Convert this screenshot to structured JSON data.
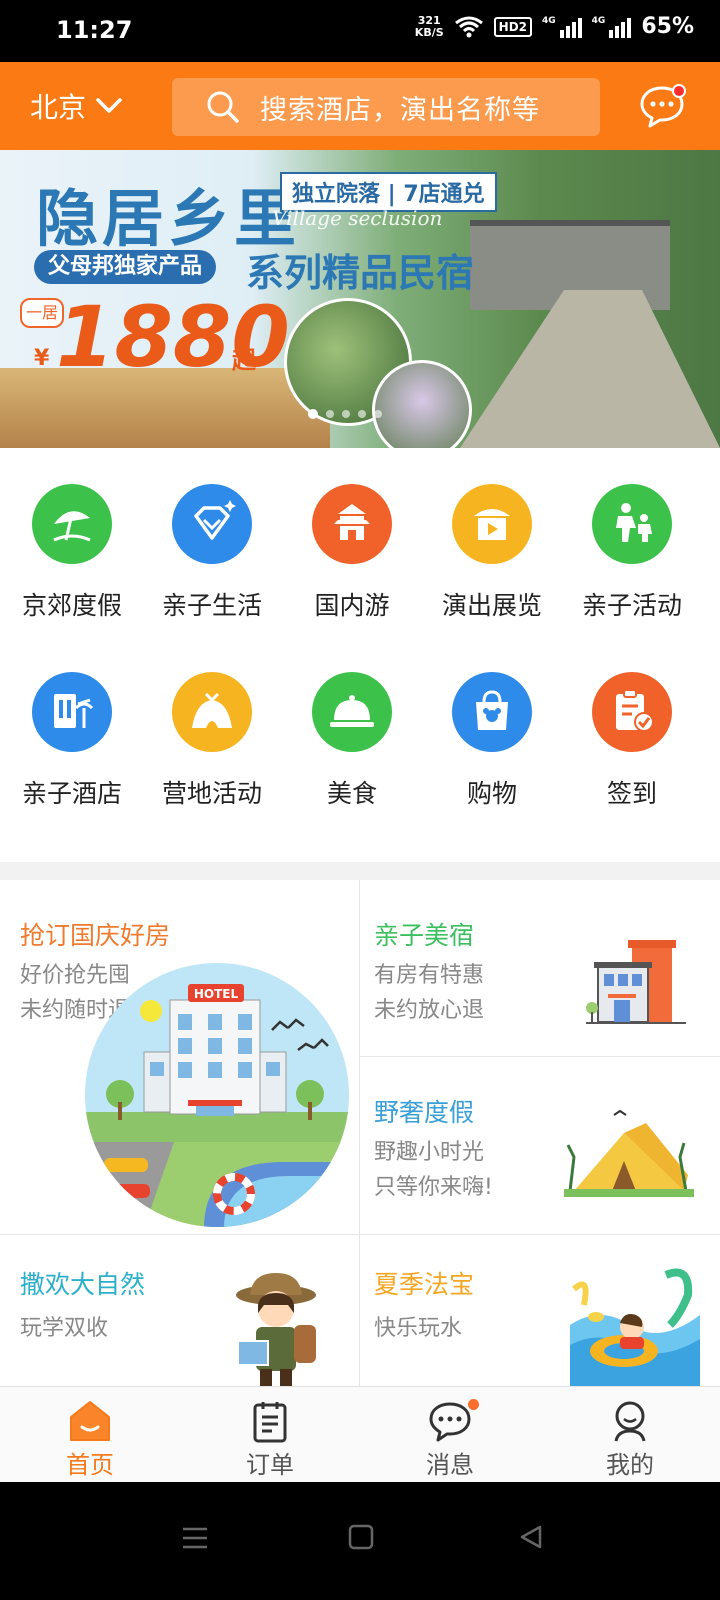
{
  "status_bar": {
    "time": "11:27",
    "speed_value": "321",
    "speed_unit": "KB/S",
    "hd": "HD2",
    "net1": "4G",
    "net2": "4G",
    "battery": "65%"
  },
  "header": {
    "city": "北京",
    "search_placeholder": "搜索酒店，演出名称等",
    "accent": "#fb7a14"
  },
  "banner": {
    "title": "隐居乡里",
    "tag": "独立院落 | 7店通兑",
    "english": "Village seclusion",
    "pill": "父母邦独家产品",
    "subtitle": "系列精品民宿",
    "prefix": "一居",
    "currency": "¥",
    "price": "1880",
    "suffix": "起",
    "slide_count": 5,
    "active_slide": 1
  },
  "categories": [
    {
      "label": "京郊度假",
      "icon": "beach-umbrella-icon",
      "color": "#3cc24a"
    },
    {
      "label": "亲子生活",
      "icon": "diamond-icon",
      "color": "#2e8bea"
    },
    {
      "label": "国内游",
      "icon": "temple-icon",
      "color": "#f1622a"
    },
    {
      "label": "演出展览",
      "icon": "play-tent-icon",
      "color": "#f7b421"
    },
    {
      "label": "亲子活动",
      "icon": "parent-child-icon",
      "color": "#3cc24a"
    },
    {
      "label": "亲子酒店",
      "icon": "hotel-palm-icon",
      "color": "#2e8bea"
    },
    {
      "label": "营地活动",
      "icon": "camp-tent-icon",
      "color": "#f7b421"
    },
    {
      "label": "美食",
      "icon": "food-cloche-icon",
      "color": "#3cc24a"
    },
    {
      "label": "购物",
      "icon": "shopping-bag-icon",
      "color": "#2e8bea"
    },
    {
      "label": "签到",
      "icon": "checkin-clipboard-icon",
      "color": "#f1622a"
    }
  ],
  "features": [
    {
      "title": "抢订国庆好房",
      "line1": "好价抢先囤",
      "line2": "未约随时退",
      "title_color": "#f07a2e",
      "image": "hotel-illustration"
    },
    {
      "title": "亲子美宿",
      "line1": "有房有特惠",
      "line2": "未约放心退",
      "title_color": "#3cbf5e",
      "image": "building-illustration"
    },
    {
      "title": "野奢度假",
      "line1": "野趣小时光",
      "line2": "只等你来嗨!",
      "title_color": "#3a9fd6",
      "image": "tent-illustration"
    },
    {
      "title": "撒欢大自然",
      "line1": "玩学双收",
      "line2": "",
      "title_color": "#2ab0c9",
      "image": "explorer-illustration"
    },
    {
      "title": "夏季法宝",
      "line1": "快乐玩水",
      "line2": "",
      "title_color": "#f5a623",
      "image": "swim-illustration"
    }
  ],
  "bottom_nav": [
    {
      "label": "首页",
      "icon": "home-icon",
      "active": true
    },
    {
      "label": "订单",
      "icon": "order-list-icon",
      "active": false
    },
    {
      "label": "消息",
      "icon": "message-icon",
      "active": false,
      "badge": true
    },
    {
      "label": "我的",
      "icon": "profile-icon",
      "active": false
    }
  ]
}
